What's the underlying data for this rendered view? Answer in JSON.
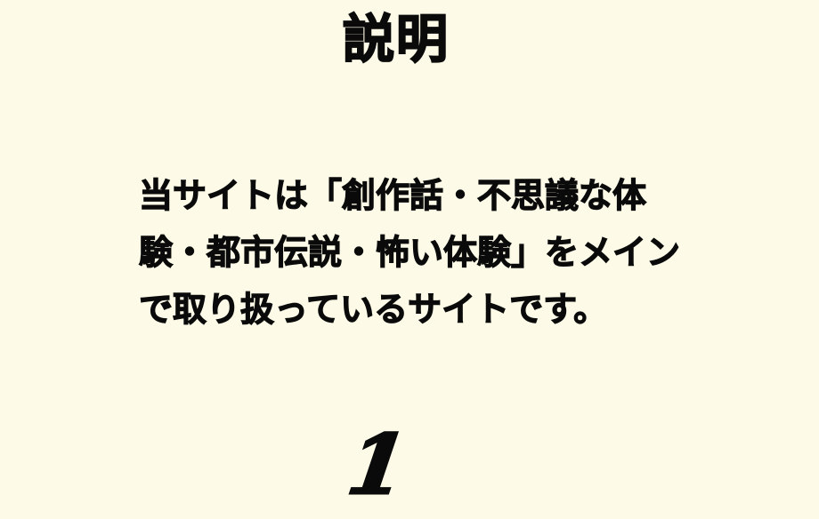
{
  "title": "説明",
  "description": "当サイトは「創作話・不思議な体験・都市伝説・怖い体験」をメインで取り扱っているサイトです。",
  "page_number": "1",
  "colors": {
    "background": "#fdfbe8",
    "text": "#0a0a0a"
  }
}
